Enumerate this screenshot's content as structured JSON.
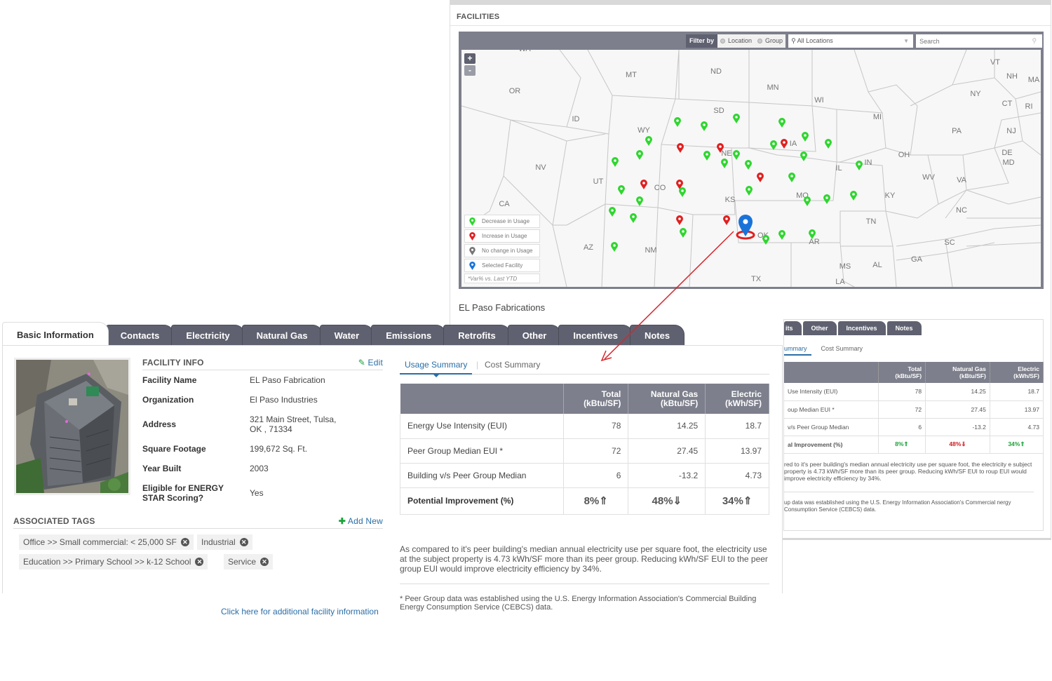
{
  "facilities_window": {
    "title": "FACILITIES",
    "filter": {
      "label": "Filter by",
      "option_location": "Location",
      "option_group": "Group",
      "location_select": "All Locations",
      "search_placeholder": "Search"
    },
    "zoom_in": "+",
    "zoom_out": "-",
    "state_labels": [
      "WA",
      "OR",
      "CA",
      "NV",
      "ID",
      "MT",
      "WY",
      "UT",
      "AZ",
      "CO",
      "NM",
      "ND",
      "SD",
      "NE",
      "KS",
      "OK",
      "TX",
      "MN",
      "IA",
      "MO",
      "AR",
      "LA",
      "WI",
      "MI",
      "IL",
      "IN",
      "OH",
      "KY",
      "TN",
      "MS",
      "AL",
      "GA",
      "SC",
      "NC",
      "VA",
      "WV",
      "PA",
      "NY",
      "VT",
      "NH",
      "MA",
      "CT",
      "RI",
      "NJ",
      "DE",
      "MD"
    ],
    "legend": {
      "decrease": "Decrease in Usage",
      "increase": "Increase in Usage",
      "no_change": "No change in Usage",
      "selected": "Selected Facility",
      "note": "*Var% vs. Last YTD"
    },
    "colors": {
      "decrease": "#2fd62f",
      "increase": "#e02020",
      "no_change": "#777777",
      "selected": "#1a73d9"
    },
    "selected_facility_name": "EL Paso Fabrications",
    "partial_panel": {
      "tabs": [
        "its",
        "Other",
        "Incentives",
        "Notes"
      ],
      "subtab_active": "ummary",
      "subtab_cost": "Cost Summary",
      "headers": [
        "Total (kBtu/SF)",
        "Natural Gas (kBtu/SF)",
        "Electric (kWh/SF)"
      ],
      "rows": [
        {
          "label": "Use Intensity (EUI)",
          "total": "78",
          "gas": "14.25",
          "electric": "18.7"
        },
        {
          "label": "oup Median EUI *",
          "total": "72",
          "gas": "27.45",
          "electric": "13.97"
        },
        {
          "label": "v/s Peer Group Median",
          "total": "6",
          "gas": "-13.2",
          "electric": "4.73"
        },
        {
          "label": "al Improvement (%)",
          "total": "8%⇑",
          "gas": "48%⇓",
          "electric": "34%⇑"
        }
      ],
      "paragraph": "red to it's peer building's median annual electricity use per square foot, the electricity e subject property is 4.73 kWh/SF more than its peer group. Reducing kWh/SF EUI to roup EUI would improve electricity efficiency by 34%.",
      "footnote": "up data was established using the U.S. Energy Information Association's Commercial nergy Consumption Service (CEBCS) data."
    }
  },
  "detail_panel": {
    "tabs": [
      "Basic Information",
      "Contacts",
      "Electricity",
      "Natural Gas",
      "Water",
      "Emissions",
      "Retrofits",
      "Other",
      "Incentives",
      "Notes"
    ],
    "active_tab": "Basic Information",
    "facility_info": {
      "heading": "FACILITY INFO",
      "edit_label": "Edit",
      "rows": [
        {
          "label": "Facility Name",
          "value": "EL Paso Fabrication"
        },
        {
          "label": "Organization",
          "value": "El Paso Industries"
        },
        {
          "label": "Address",
          "value": "321 Main Street, Tulsa, OK , 71334"
        },
        {
          "label": "Square Footage",
          "value": "199,672 Sq. Ft."
        },
        {
          "label": "Year Built",
          "value": "2003"
        },
        {
          "label": "Eligible for ENERGY STAR Scoring?",
          "value": "Yes"
        }
      ]
    },
    "tags": {
      "heading": "ASSOCIATED TAGS",
      "add_label": "Add New",
      "items": [
        "Office >> Small commercial: < 25,000 SF",
        "Industrial",
        "Education >> Primary School >> k-12 School",
        "Service"
      ]
    },
    "more_info_link": "Click here for additional facility information",
    "summary": {
      "subtab_usage": "Usage Summary",
      "subtab_cost": "Cost Summary",
      "headers": {
        "total": [
          "Total",
          "(kBtu/SF)"
        ],
        "gas": [
          "Natural Gas",
          "(kBtu/SF)"
        ],
        "electric": [
          "Electric",
          "(kWh/SF)"
        ]
      },
      "rows": [
        {
          "label": "Energy Use Intensity (EUI)",
          "total": "78",
          "gas": "14.25",
          "electric": "18.7"
        },
        {
          "label": "Peer Group Median EUI *",
          "total": "72",
          "gas": "27.45",
          "electric": "13.97"
        },
        {
          "label": "Building v/s Peer Group Median",
          "total": "6",
          "gas": "-13.2",
          "electric": "4.73"
        }
      ],
      "potential": {
        "label": "Potential Improvement (%)",
        "total": "8%⇑",
        "gas": "48%⇓",
        "electric": "34%⇑"
      },
      "paragraph": "As compared to it's peer building's median annual electricity use per square foot, the electricity use at the subject property is 4.73 kWh/SF more than its peer group. Reducing kWh/SF EUI to the peer group EUI would improve electricity efficiency by 34%.",
      "footnote": "* Peer Group data was established using the U.S. Energy Information Association's Commercial Building Energy Consumption Service (CEBCS) data."
    }
  }
}
